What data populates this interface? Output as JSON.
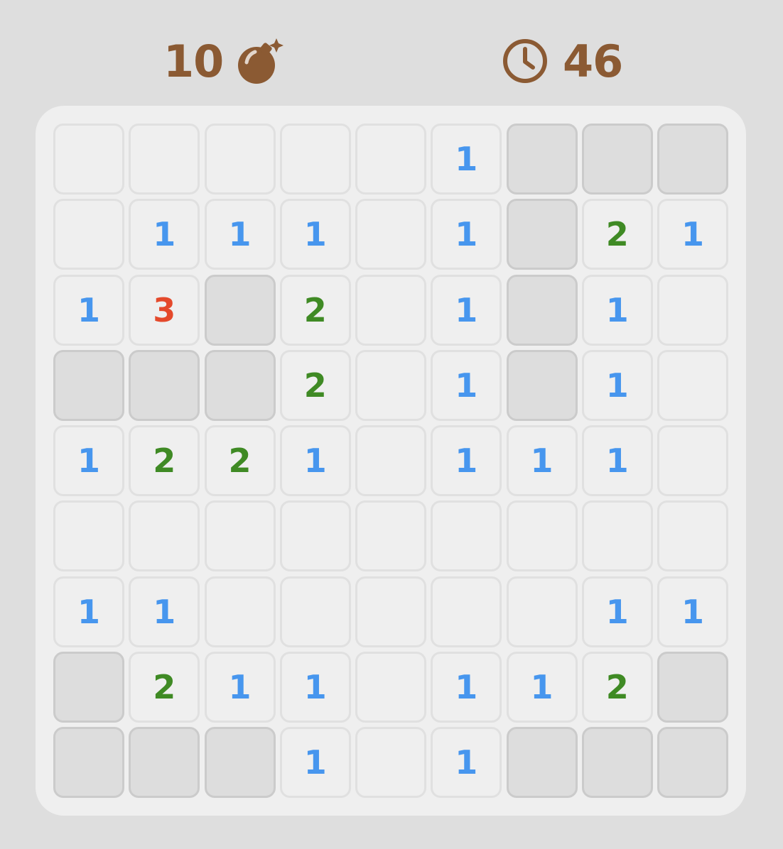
{
  "header": {
    "mines_remaining": "10",
    "mine_icon": "bomb-icon",
    "timer_icon": "clock-icon",
    "elapsed_seconds": "46"
  },
  "colors": {
    "header_text": "#8b5a33",
    "number_1": "#4796ee",
    "number_2": "#3f8a24",
    "number_3": "#e4492b",
    "hidden_cell": "#dddddd",
    "revealed_cell": "#efefef"
  },
  "board": {
    "rows": 9,
    "cols": 9,
    "legend": "H = unrevealed cell, empty string = revealed blank, digit = adjacent mine count",
    "cells": [
      [
        "",
        "",
        "",
        "",
        "",
        "1",
        "H",
        "H",
        "H"
      ],
      [
        "",
        "1",
        "1",
        "1",
        "",
        "1",
        "H",
        "2",
        "1"
      ],
      [
        "1",
        "3",
        "H",
        "2",
        "",
        "1",
        "H",
        "1",
        ""
      ],
      [
        "H",
        "H",
        "H",
        "2",
        "",
        "1",
        "H",
        "1",
        ""
      ],
      [
        "1",
        "2",
        "2",
        "1",
        "",
        "1",
        "1",
        "1",
        ""
      ],
      [
        "",
        "",
        "",
        "",
        "",
        "",
        "",
        "",
        ""
      ],
      [
        "1",
        "1",
        "",
        "",
        "",
        "",
        "",
        "1",
        "1"
      ],
      [
        "H",
        "2",
        "1",
        "1",
        "",
        "1",
        "1",
        "2",
        "H"
      ],
      [
        "H",
        "H",
        "H",
        "1",
        "",
        "1",
        "H",
        "H",
        "H"
      ]
    ]
  }
}
